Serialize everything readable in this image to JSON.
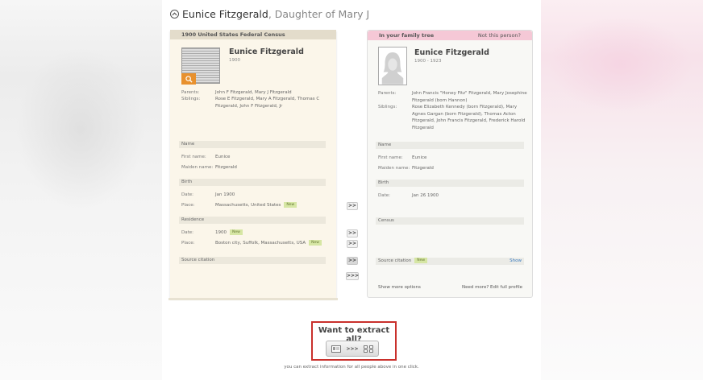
{
  "header": {
    "name": "Eunice Fitzgerald",
    "relation": ", Daughter of Mary J"
  },
  "left": {
    "source_title": "1900 United States Federal Census",
    "name": "Eunice Fitzgerald",
    "dates": "1900",
    "parents_label": "Parents:",
    "parents": "John F Fitzgerald, Mary J Fitzgerald",
    "siblings_label": "Siblings:",
    "siblings_line1": "Rose E Fitzgerald, Mary A Fitzgerald, Thomas C",
    "siblings_line2": "Fitzgerald, John F Fitzgerald, Jr",
    "name_section": "Name",
    "first_name_label": "First name:",
    "first_name": "Eunice",
    "maiden_name_label": "Maiden name:",
    "maiden_name": "Fitzgerald",
    "birth_section": "Birth",
    "birth_date_label": "Date:",
    "birth_date": "Jan 1900",
    "birth_place_label": "Place:",
    "birth_place": "Massachusetts, United States",
    "residence_section": "Residence",
    "res_date_label": "Date:",
    "res_date": "1900",
    "res_place_label": "Place:",
    "res_place": "Boston city, Suffolk, Massachusetts, USA",
    "source_citation": "Source citation",
    "new_badge": "New"
  },
  "right": {
    "header_title": "In your family tree",
    "not_this_person": "Not this person?",
    "name": "Eunice Fitzgerald",
    "dates": "1900 - 1923",
    "parents_label": "Parents:",
    "parents_line1": "John Francis \"Honey Fitz\" Fitzgerald, Mary Josephine",
    "parents_line2": "Fitzgerald (born Hannon)",
    "siblings_label": "Siblings:",
    "siblings_line1": "Rose Elizabeth Kennedy (born Fitzgerald), Mary",
    "siblings_line2": "Agnes Gargan (born Fitzgerald), Thomas Acton",
    "siblings_line3": "Fitzgerald, John Francis Fitzgerald, Frederick Harold",
    "siblings_line4": "Fitzgerald",
    "name_section": "Name",
    "first_name_label": "First name:",
    "first_name": "Eunice",
    "maiden_name_label": "Maiden name:",
    "maiden_name": "Fitzgerald",
    "birth_section": "Birth",
    "birth_date_label": "Date:",
    "birth_date": "Jan 26 1900",
    "census_section": "Census",
    "source_citation": "Source citation",
    "new_badge": "New",
    "show": "Show",
    "show_more": "Show more options",
    "need_more": "Need more? Edit full profile"
  },
  "arrows": {
    "double": ">>",
    "triple": ">>>"
  },
  "extract": {
    "title": "Want to extract all?",
    "arrows": ">>>",
    "description": "you can extract information for all people above in one click."
  },
  "colors": {
    "left_panel_bg": "#fbf6ea",
    "right_header": "#f5c8d6",
    "extract_border": "#c9302c",
    "new_badge": "#d6e6a4"
  }
}
